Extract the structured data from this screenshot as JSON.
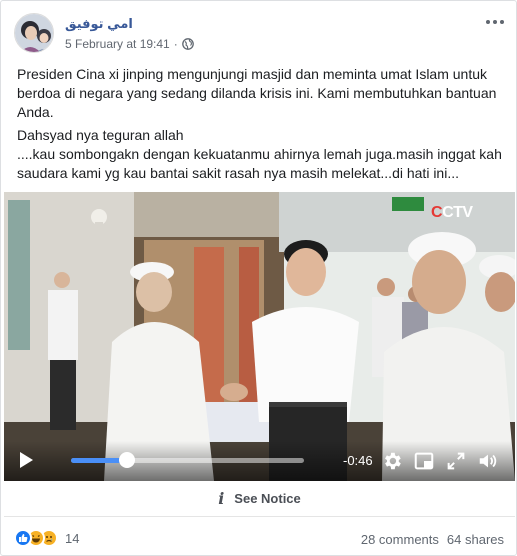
{
  "post": {
    "author": "امي توفيق",
    "timestamp": "5 February at 19:41",
    "separator": "·",
    "privacy_icon": "globe-icon",
    "more_icon": "more-options-icon",
    "paragraphs": [
      "Presiden Cina xi jinping mengunjungi masjid dan meminta umat Islam untuk berdoa di negara yang sedang dilanda krisis ini. Kami membutuhkan bantuan Anda.",
      "Dahsyad nya teguran allah",
      "....kau sombongakn dengan kekuatanmu ahirnya lemah juga.masih inggat kah saudara kami yg kau bantai sakit rasah nya masih melekat...di hati ini..."
    ]
  },
  "video": {
    "watermark_prefix": "C",
    "watermark_rest": "CTV",
    "time_remaining": "-0:46",
    "progress": 0.24,
    "accent_color": "#4a8ff7",
    "icons": [
      "play-icon",
      "settings-icon",
      "picture-in-picture-icon",
      "fullscreen-icon",
      "volume-icon"
    ]
  },
  "notice": {
    "icon_glyph": "i",
    "label": "See Notice"
  },
  "footer": {
    "reaction_count": "14",
    "comments": "28 comments",
    "shares": "64 shares",
    "reaction_icons": [
      "like-icon",
      "haha-icon",
      "sad-icon"
    ]
  }
}
